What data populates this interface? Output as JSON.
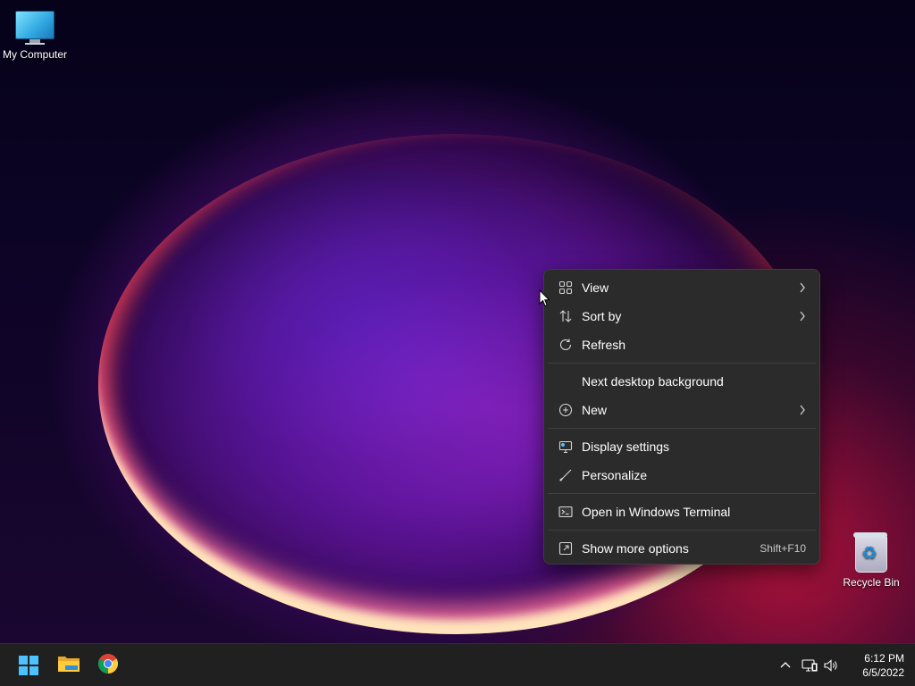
{
  "desktop": {
    "icons": [
      {
        "label": "My Computer",
        "icon": "monitor-icon"
      },
      {
        "label": "Recycle Bin",
        "icon": "recycle-bin-icon"
      }
    ]
  },
  "context_menu": {
    "items": [
      {
        "label": "View",
        "icon": "grid-icon",
        "submenu": true
      },
      {
        "label": "Sort by",
        "icon": "sort-arrows-icon",
        "submenu": true
      },
      {
        "label": "Refresh",
        "icon": "refresh-icon",
        "submenu": false
      },
      {
        "label": "Next desktop background",
        "icon": "",
        "submenu": false
      },
      {
        "label": "New",
        "icon": "plus-circle-icon",
        "submenu": true
      },
      {
        "label": "Display settings",
        "icon": "display-settings-icon",
        "submenu": false
      },
      {
        "label": "Personalize",
        "icon": "brush-icon",
        "submenu": false
      },
      {
        "label": "Open in Windows Terminal",
        "icon": "terminal-icon",
        "submenu": false
      },
      {
        "label": "Show more options",
        "icon": "external-options-icon",
        "submenu": false,
        "shortcut": "Shift+F10"
      }
    ]
  },
  "taskbar": {
    "apps": [
      {
        "name": "Start",
        "icon": "windows-logo-icon"
      },
      {
        "name": "File Explorer",
        "icon": "folder-icon"
      },
      {
        "name": "Google Chrome",
        "icon": "chrome-icon"
      }
    ],
    "tray": {
      "icons": [
        "chevron-up-icon",
        "network-icon",
        "volume-icon"
      ]
    },
    "clock": {
      "time": "6:12 PM",
      "date": "6/5/2022"
    }
  },
  "colors": {
    "menu_bg": "#2b2b2b",
    "taskbar_bg": "#202020",
    "windows_accent": "#4cc2ff"
  }
}
